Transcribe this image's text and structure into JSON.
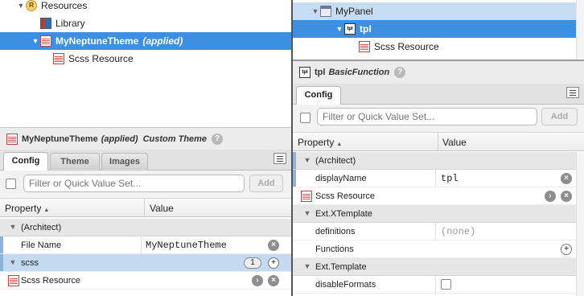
{
  "left": {
    "tree": [
      {
        "label": "Resources",
        "icon": "resources-icon",
        "expander": "▼",
        "indent": 0,
        "state": "normal"
      },
      {
        "label": "Library",
        "icon": "library-icon",
        "expander": "",
        "indent": 1,
        "state": "normal"
      },
      {
        "label": "MyNeptuneTheme",
        "suffix": "(applied)",
        "icon": "scss-resource-icon",
        "expander": "▼",
        "indent": 1,
        "state": "selected"
      },
      {
        "label": "Scss Resource",
        "icon": "scss-resource-icon",
        "expander": "",
        "indent": 2,
        "state": "normal"
      }
    ],
    "inspector": {
      "title": "MyNeptuneTheme",
      "status": "(applied)",
      "type": "Custom Theme",
      "tabs": [
        "Config",
        "Theme",
        "Images"
      ],
      "active_tab": "Config",
      "filter_placeholder": "Filter or Quick Value Set...",
      "add_label": "Add",
      "col_property": "Property",
      "col_value": "Value",
      "rows": {
        "architect": "(Architect)",
        "file_name_label": "File Name",
        "file_name_value": "MyNeptuneTheme",
        "scss_label": "scss",
        "scss_count": "1",
        "scss_resource_label": "Scss Resource"
      }
    }
  },
  "right": {
    "tree": [
      {
        "label": "MyPanel",
        "icon": "panel-icon",
        "expander": "▼",
        "state": "hl"
      },
      {
        "label": "tpl",
        "icon": "tpl-icon",
        "expander": "▼",
        "state": "selected"
      },
      {
        "label": "Scss Resource",
        "icon": "scss-resource-icon",
        "expander": "",
        "state": "normal"
      }
    ],
    "inspector": {
      "title": "tpl",
      "type": "BasicFunction",
      "tabs": [
        "Config"
      ],
      "active_tab": "Config",
      "filter_placeholder": "Filter or Quick Value Set...",
      "add_label": "Add",
      "col_property": "Property",
      "col_value": "Value",
      "rows": {
        "architect": "(Architect)",
        "display_name_label": "displayName",
        "display_name_value": "tpl",
        "scss_resource_label": "Scss Resource",
        "xtemplate": "Ext.XTemplate",
        "definitions_label": "definitions",
        "definitions_value": "(none)",
        "functions_label": "Functions",
        "template": "Ext.Template",
        "disable_formats_label": "disableFormats"
      }
    }
  },
  "colors": {
    "selection": "#3d8fe4",
    "highlight": "#c5dcf3",
    "row_selected": "#c3daf0"
  }
}
